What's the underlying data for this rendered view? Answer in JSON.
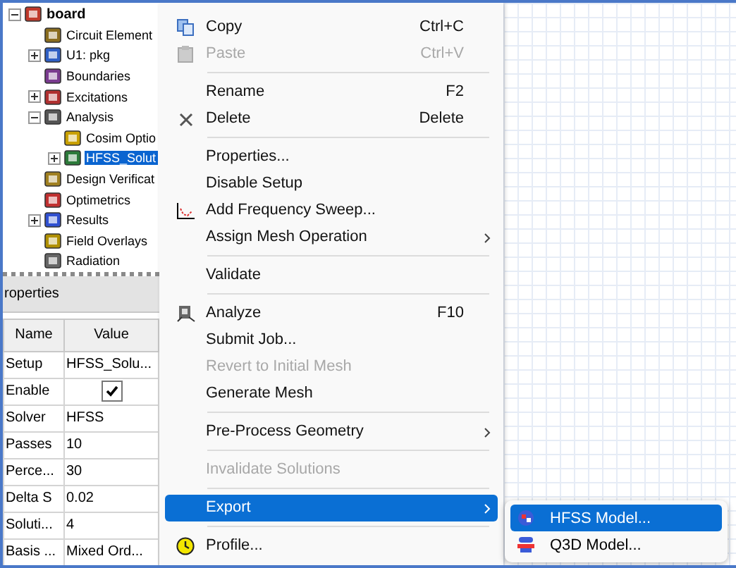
{
  "tree": {
    "label": "board",
    "expanded": true,
    "selected": false,
    "children": [
      {
        "label": "Circuit Element",
        "selected": false
      },
      {
        "label": "U1: pkg",
        "expanded": false,
        "selected": false
      },
      {
        "label": "Boundaries",
        "selected": false
      },
      {
        "label": "Excitations",
        "expanded": false,
        "selected": false
      },
      {
        "label": "Analysis",
        "expanded": true,
        "selected": false,
        "children": [
          {
            "label": "Cosim Optio",
            "selected": false
          },
          {
            "label": "HFSS_Solut",
            "expanded": false,
            "selected": true
          }
        ]
      },
      {
        "label": "Design Verificat",
        "selected": false
      },
      {
        "label": "Optimetrics",
        "selected": false
      },
      {
        "label": "Results",
        "expanded": false,
        "selected": false
      },
      {
        "label": "Field Overlays",
        "selected": false
      },
      {
        "label": "Radiation",
        "selected": false
      }
    ]
  },
  "properties": {
    "title": "roperties",
    "columns": [
      "Name",
      "Value"
    ],
    "rows": [
      {
        "name": "Setup",
        "kind": "text",
        "value": "HFSS_Solu..."
      },
      {
        "name": "Enable",
        "kind": "checkbox",
        "checked": true
      },
      {
        "name": "Solver",
        "kind": "text",
        "value": "HFSS"
      },
      {
        "name": "Passes",
        "kind": "text",
        "value": "10"
      },
      {
        "name": "Perce...",
        "kind": "text",
        "value": "30"
      },
      {
        "name": "Delta S",
        "kind": "text",
        "value": "0.02"
      },
      {
        "name": "Soluti...",
        "kind": "text",
        "value": "4"
      },
      {
        "name": "Basis ...",
        "kind": "text",
        "value": "Mixed Ord..."
      }
    ]
  },
  "context_menu": [
    {
      "kind": "item",
      "label": "Copy",
      "shortcut": "Ctrl+C",
      "disabled": false,
      "selected": false,
      "submenu": false
    },
    {
      "kind": "item",
      "label": "Paste",
      "shortcut": "Ctrl+V",
      "disabled": true,
      "selected": false,
      "submenu": false
    },
    {
      "kind": "separator"
    },
    {
      "kind": "item",
      "label": "Rename",
      "shortcut": "F2",
      "disabled": false,
      "selected": false,
      "submenu": false
    },
    {
      "kind": "item",
      "label": "Delete",
      "shortcut": "Delete",
      "disabled": false,
      "selected": false,
      "submenu": false
    },
    {
      "kind": "separator"
    },
    {
      "kind": "item",
      "label": "Properties...",
      "disabled": false,
      "selected": false,
      "submenu": false
    },
    {
      "kind": "item",
      "label": "Disable Setup",
      "disabled": false,
      "selected": false,
      "submenu": false
    },
    {
      "kind": "item",
      "label": "Add Frequency Sweep...",
      "disabled": false,
      "selected": false,
      "submenu": false
    },
    {
      "kind": "item",
      "label": "Assign Mesh Operation",
      "disabled": false,
      "selected": false,
      "submenu": true
    },
    {
      "kind": "separator"
    },
    {
      "kind": "item",
      "label": "Validate",
      "disabled": false,
      "selected": false,
      "submenu": false
    },
    {
      "kind": "separator"
    },
    {
      "kind": "item",
      "label": "Analyze",
      "shortcut": "F10",
      "disabled": false,
      "selected": false,
      "submenu": false
    },
    {
      "kind": "item",
      "label": "Submit Job...",
      "disabled": false,
      "selected": false,
      "submenu": false
    },
    {
      "kind": "item",
      "label": "Revert to Initial Mesh",
      "disabled": true,
      "selected": false,
      "submenu": false
    },
    {
      "kind": "item",
      "label": "Generate Mesh",
      "disabled": false,
      "selected": false,
      "submenu": false
    },
    {
      "kind": "separator"
    },
    {
      "kind": "item",
      "label": "Pre-Process Geometry",
      "disabled": false,
      "selected": false,
      "submenu": true
    },
    {
      "kind": "separator"
    },
    {
      "kind": "item",
      "label": "Invalidate Solutions",
      "disabled": true,
      "selected": false,
      "submenu": false
    },
    {
      "kind": "separator"
    },
    {
      "kind": "item",
      "label": "Export",
      "disabled": false,
      "selected": true,
      "submenu": true
    },
    {
      "kind": "separator"
    },
    {
      "kind": "item",
      "label": "Profile...",
      "disabled": false,
      "selected": false,
      "submenu": false
    }
  ],
  "submenu": [
    {
      "label": "HFSS Model...",
      "selected": true
    },
    {
      "label": "Q3D Model...",
      "selected": false
    }
  ]
}
